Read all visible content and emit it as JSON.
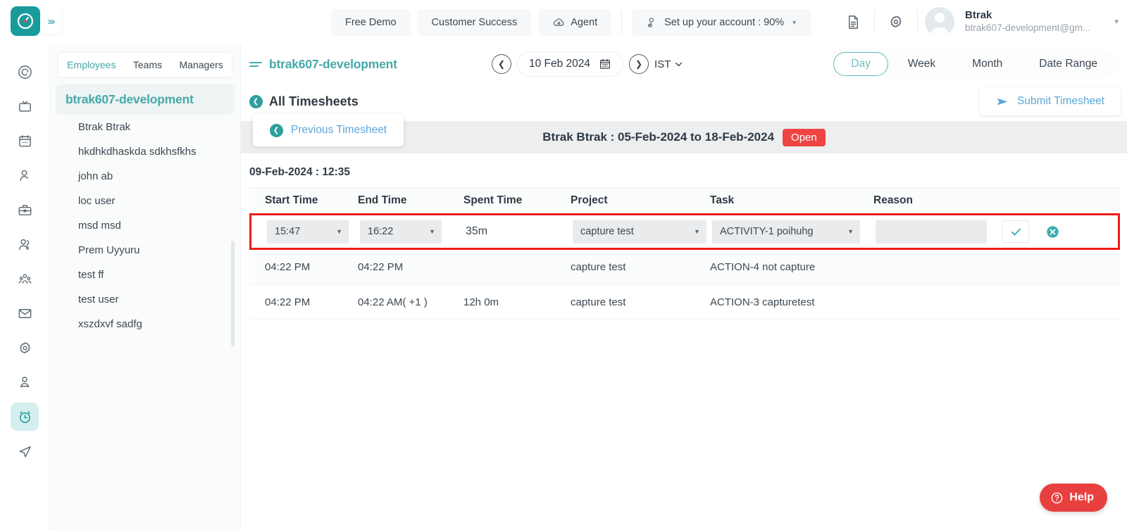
{
  "topbar": {
    "logo_icon": "clock-logo-icon",
    "expand_icon": "chevrons-right-icon",
    "buttons": [
      {
        "label": "Free Demo",
        "name": "free-demo-button"
      },
      {
        "label": "Customer Success",
        "name": "customer-success-button"
      },
      {
        "label": "Agent",
        "name": "agent-button",
        "icon": "cloud-download-icon"
      }
    ],
    "setup": {
      "label": "Set up your account : 90%",
      "icon": "user-settings-icon"
    },
    "doc_icon": "document-icon",
    "gear_icon": "gear-icon",
    "user": {
      "name": "Btrak",
      "email": "btrak607-development@gm...",
      "avatar_icon": "avatar-icon",
      "caret_icon": "chevron-down-icon"
    }
  },
  "rail": {
    "items": [
      {
        "icon": "spiral-icon",
        "name": "rail-item-dashboard",
        "active": false
      },
      {
        "icon": "tv-icon",
        "name": "rail-item-screen",
        "active": false
      },
      {
        "icon": "calendar-icon",
        "name": "rail-item-calendar",
        "active": false
      },
      {
        "icon": "person-icon",
        "name": "rail-item-profile",
        "active": false
      },
      {
        "icon": "briefcase-icon",
        "name": "rail-item-projects",
        "active": false
      },
      {
        "icon": "two-users-icon",
        "name": "rail-item-teams",
        "active": false
      },
      {
        "icon": "group-people-icon",
        "name": "rail-item-org",
        "active": false
      },
      {
        "icon": "envelope-icon",
        "name": "rail-item-mail",
        "active": false
      },
      {
        "icon": "gear-icon",
        "name": "rail-item-settings",
        "active": false
      },
      {
        "icon": "person-badge-icon",
        "name": "rail-item-hr",
        "active": false
      },
      {
        "icon": "alarm-clock-icon",
        "name": "rail-item-timesheets",
        "active": true
      },
      {
        "icon": "send-icon",
        "name": "rail-item-send",
        "active": false
      }
    ]
  },
  "employee_panel": {
    "tabs": [
      {
        "label": "Employees",
        "active": true
      },
      {
        "label": "Teams",
        "active": false
      },
      {
        "label": "Managers",
        "active": false
      }
    ],
    "group_header": "btrak607-development",
    "employees": [
      "Btrak Btrak",
      "hkdhkdhaskda sdkhsfkhs",
      "john ab",
      "loc user",
      "msd msd",
      "Prem Uyyuru",
      "test ff",
      "test user",
      "xszdxvf sadfg"
    ]
  },
  "main_header": {
    "project_title": "btrak607-development",
    "menu_icon": "hamburger-icon",
    "prev_day_icon": "chevron-left-circle-icon",
    "next_day_icon": "chevron-right-circle-icon",
    "date": "10 Feb 2024",
    "calendar_icon": "calendar-icon",
    "timezone": "IST",
    "timezone_caret_icon": "chevron-down-icon",
    "view_tabs": [
      {
        "label": "Day",
        "active": true
      },
      {
        "label": "Week",
        "active": false
      },
      {
        "label": "Month",
        "active": false
      },
      {
        "label": "Date Range",
        "active": false
      }
    ]
  },
  "sub_header": {
    "back_label": "All Timesheets",
    "back_icon": "back-circle-icon",
    "submit_label": "Submit Timesheet",
    "submit_icon": "send-icon"
  },
  "timesheet_bar": {
    "previous_label": "Previous Timesheet",
    "previous_icon": "back-circle-icon",
    "title": "Btrak Btrak : 05-Feb-2024 to 18-Feb-2024",
    "status": "Open",
    "status_color": "#ef4444"
  },
  "table": {
    "date_label": "09-Feb-2024 : 12:35",
    "columns": [
      "Start Time",
      "End Time",
      "Spent Time",
      "Project",
      "Task",
      "Reason"
    ],
    "edit_row": {
      "start_time": "15:47",
      "end_time": "16:22",
      "spent_time": "35m",
      "project": "capture test",
      "task": "ACTIVITY-1 poihuhg",
      "reason": "",
      "reason_placeholder": "",
      "confirm_icon": "check-icon",
      "cancel_icon": "close-circle-icon",
      "highlight_color": "#ee1c1c"
    },
    "rows": [
      {
        "start_time": "04:22 PM",
        "end_time": "04:22 PM",
        "spent_time": "",
        "project": "capture test",
        "task": "ACTION-4 not capture",
        "reason": ""
      },
      {
        "start_time": "04:22 PM",
        "end_time": "04:22 AM( +1 )",
        "spent_time": "12h 0m",
        "project": "capture test",
        "task": "ACTION-3 capturetest",
        "reason": ""
      }
    ]
  },
  "help": {
    "label": "Help",
    "icon": "question-circle-icon",
    "color": "#e8403f"
  }
}
